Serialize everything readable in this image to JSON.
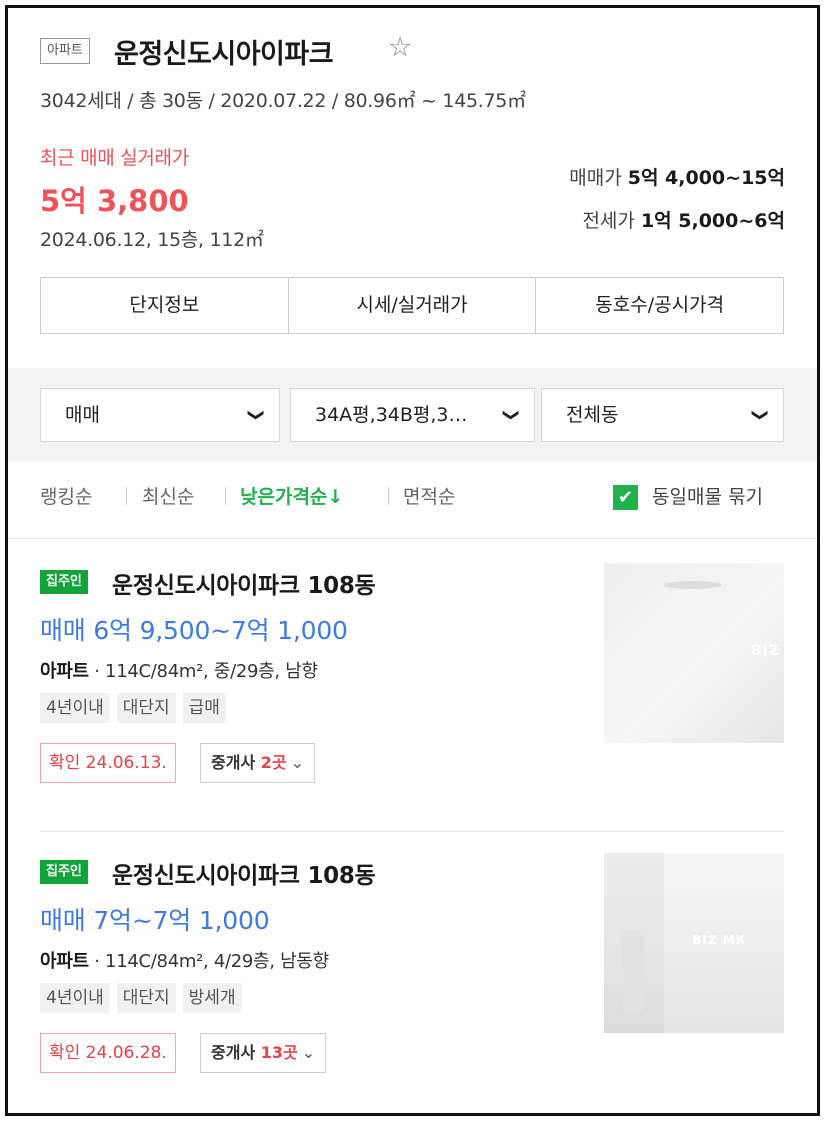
{
  "complex": {
    "type_badge": "아파트",
    "name": "운정신도시아이파크",
    "meta": "3042세대 / 총 30동 / 2020.07.22 / 80.96㎡ ~ 145.75㎡",
    "recent_label": "최근 매매 실거래가",
    "recent_price": "5억 3,800",
    "recent_date": "2024.06.12, 15층, 112㎡",
    "sale_range_label": "매매가",
    "sale_range_value": "5억 4,000~15억",
    "rent_range_label": "전세가",
    "rent_range_value": "1억 5,000~6억",
    "star_icon": "star-outline-icon"
  },
  "tabs": [
    "단지정보",
    "시세/실거래가",
    "동호수/공시가격"
  ],
  "filters": {
    "trade_type": "매매",
    "area": "34A평,34B평,3…",
    "building": "전체동"
  },
  "sort": {
    "options": [
      "랭킹순",
      "최신순",
      "낮은가격순↓",
      "면적순"
    ],
    "active": "낮은가격순↓",
    "group_label": "동일매물 묶기",
    "group_checked": true
  },
  "listings": [
    {
      "badge": "집주인",
      "title": "운정신도시아이파크 108동",
      "price": "매매 6억 9,500~7억 1,000",
      "type": "아파트",
      "spec": " · 114C/84m², 중/29층, 남향",
      "tags": [
        "4년이내",
        "대단지",
        "급매"
      ],
      "confirm": "확인 24.06.13.",
      "agency_label": "중개사 ",
      "agency_count": "2곳",
      "photo_watermark": "BIZ"
    },
    {
      "badge": "집주인",
      "title": "운정신도시아이파크 108동",
      "price": "매매 7억~7억 1,000",
      "type": "아파트",
      "spec": " · 114C/84m², 4/29층, 남동향",
      "tags": [
        "4년이내",
        "대단지",
        "방세개"
      ],
      "confirm": "확인 24.06.28.",
      "agency_label": "중개사 ",
      "agency_count": "13곳",
      "photo_watermark": "BIZ MK"
    }
  ],
  "colors": {
    "accent_red": "#f0525a",
    "accent_green": "#22b24c",
    "badge_green": "#12a33b",
    "price_blue": "#3d7be2"
  }
}
